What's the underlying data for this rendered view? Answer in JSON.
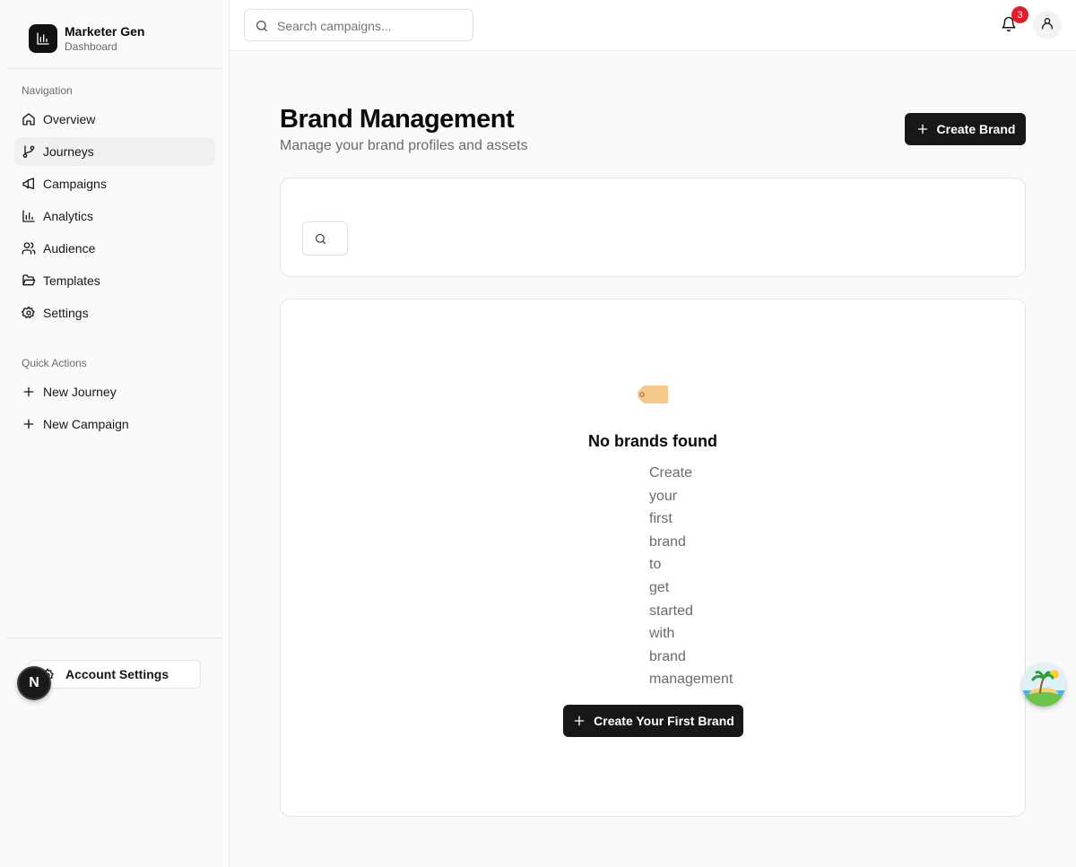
{
  "app": {
    "name": "Marketer Gen",
    "subtitle": "Dashboard"
  },
  "sidebar": {
    "nav_label": "Navigation",
    "items": [
      {
        "label": "Overview",
        "icon": "home-icon"
      },
      {
        "label": "Journeys",
        "icon": "git-branch-icon",
        "active": true
      },
      {
        "label": "Campaigns",
        "icon": "megaphone-icon"
      },
      {
        "label": "Analytics",
        "icon": "bar-chart-icon"
      },
      {
        "label": "Audience",
        "icon": "users-icon"
      },
      {
        "label": "Templates",
        "icon": "folder-open-icon"
      },
      {
        "label": "Settings",
        "icon": "gear-icon"
      }
    ],
    "quick_label": "Quick Actions",
    "quick_items": [
      {
        "label": "New Journey",
        "icon": "plus-icon"
      },
      {
        "label": "New Campaign",
        "icon": "plus-icon"
      }
    ],
    "account_label": "Account Settings",
    "avatar_letter": "N"
  },
  "topbar": {
    "search_placeholder": "Search campaigns...",
    "notification_count": "3"
  },
  "page": {
    "title": "Brand Management",
    "subtitle": "Manage your brand profiles and assets",
    "create_label": "Create Brand"
  },
  "empty_state": {
    "title": "No brands found",
    "description": "Create your first brand to get started with brand management",
    "cta_label": "Create Your First Brand"
  },
  "colors": {
    "primary": "#171717",
    "badge": "#e11d2e",
    "muted": "#6b6b6b"
  }
}
